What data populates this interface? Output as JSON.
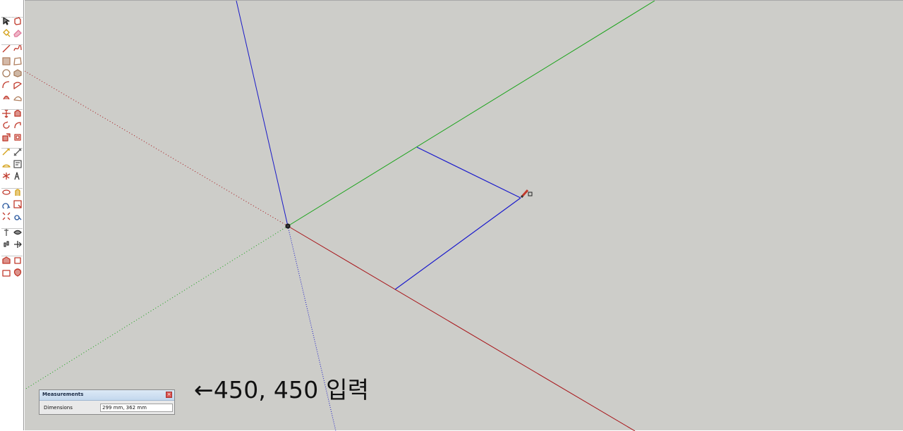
{
  "toolbar": {
    "tools": [
      {
        "name": "select-tool-icon",
        "color": "#222222"
      },
      {
        "name": "make-component-tool-icon",
        "color": "#c0392b"
      },
      {
        "name": "paint-bucket-tool-icon",
        "color": "#d4a017"
      },
      {
        "name": "eraser-tool-icon",
        "color": "#e07a9a"
      },
      {
        "name": "line-tool-icon",
        "color": "#c0392b"
      },
      {
        "name": "freehand-tool-icon",
        "color": "#c0392b"
      },
      {
        "name": "rectangle-tool-icon",
        "color": "#b08060"
      },
      {
        "name": "rotated-rectangle-tool-icon",
        "color": "#b08060"
      },
      {
        "name": "circle-tool-icon",
        "color": "#a67b5b"
      },
      {
        "name": "polygon-tool-icon",
        "color": "#a67b5b"
      },
      {
        "name": "arc-tool-icon",
        "color": "#c0392b"
      },
      {
        "name": "pie-tool-icon",
        "color": "#c0392b"
      },
      {
        "name": "three-point-arc-tool-icon",
        "color": "#c0392b"
      },
      {
        "name": "two-point-arc-tool-icon",
        "color": "#b08060"
      },
      {
        "name": "move-tool-icon",
        "color": "#c0392b"
      },
      {
        "name": "push-pull-tool-icon",
        "color": "#c0392b"
      },
      {
        "name": "rotate-tool-icon",
        "color": "#c0392b"
      },
      {
        "name": "follow-me-tool-icon",
        "color": "#c0392b"
      },
      {
        "name": "scale-tool-icon",
        "color": "#c0392b"
      },
      {
        "name": "offset-tool-icon",
        "color": "#c0392b"
      },
      {
        "name": "tape-measure-tool-icon",
        "color": "#d4a017"
      },
      {
        "name": "dimension-tool-icon",
        "color": "#555555"
      },
      {
        "name": "protractor-tool-icon",
        "color": "#d4a017"
      },
      {
        "name": "text-tool-icon",
        "color": "#555555"
      },
      {
        "name": "axes-tool-icon",
        "color": "#c0392b"
      },
      {
        "name": "3d-text-tool-icon",
        "color": "#333333"
      },
      {
        "name": "orbit-tool-icon",
        "color": "#c0392b"
      },
      {
        "name": "pan-tool-icon",
        "color": "#d4a017"
      },
      {
        "name": "zoom-tool-icon",
        "color": "#2c5aa0"
      },
      {
        "name": "zoom-window-tool-icon",
        "color": "#c0392b"
      },
      {
        "name": "zoom-extents-tool-icon",
        "color": "#c0392b"
      },
      {
        "name": "previous-view-tool-icon",
        "color": "#2c5aa0"
      },
      {
        "name": "position-camera-tool-icon",
        "color": "#555555"
      },
      {
        "name": "look-around-tool-icon",
        "color": "#333333"
      },
      {
        "name": "walk-tool-icon",
        "color": "#333333"
      },
      {
        "name": "section-plane-tool-icon",
        "color": "#333333"
      },
      {
        "name": "warehouse-tool-icon",
        "color": "#c0392b"
      },
      {
        "name": "share-model-tool-icon",
        "color": "#c0392b"
      },
      {
        "name": "extension-warehouse-tool-icon",
        "color": "#c0392b"
      },
      {
        "name": "share-component-tool-icon",
        "color": "#c0392b"
      }
    ]
  },
  "colors": {
    "viewport_bg": "#cdcdc9",
    "red_axis": "#a8151a",
    "green_axis": "#19a319",
    "blue_axis": "#1919c8",
    "blue_edge": "#1a1acc"
  },
  "annotation": {
    "text": "←450, 450 입력"
  },
  "measurements": {
    "title": "Measurements",
    "close_symbol": "×",
    "label": "Dimensions",
    "value": "299 mm, 362 mm"
  }
}
